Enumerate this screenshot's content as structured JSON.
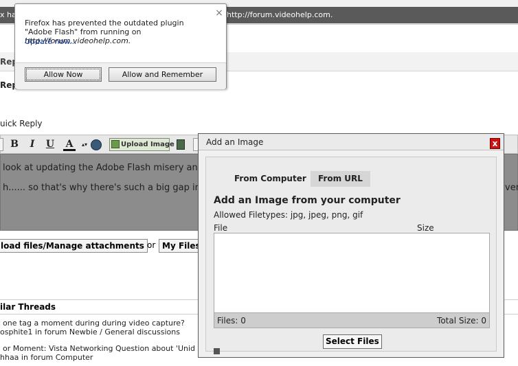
{
  "browser": {
    "notif_left": "x ha",
    "notif_right": "http://forum.videohelp.com."
  },
  "plugin_popup": {
    "message": "Firefox has prevented the outdated plugin \"Adobe Flash\" from running on",
    "url": "http://forum.videohelp.com.",
    "update_link": "Update now...",
    "allow_now": "Allow Now",
    "allow_remember": "Allow and Remember",
    "close": "×"
  },
  "forum": {
    "bar1_label": "Rep",
    "bar2_label": "Repl",
    "quick_reply": "uick Reply",
    "editor_line1": "look at updating the Adobe Flash misery and",
    "editor_line2": "h...... so that's why there's such a big gap in t",
    "editor_line2_right": "ver",
    "upload_manage": "load files/Manage attachments",
    "or": "or",
    "my_files": "My Files",
    "similar_threads": "ilar Threads",
    "threads": [
      {
        "title": "one tag a moment during during video capture?",
        "sub": "osphite1 in forum Newbie / General discussions"
      },
      {
        "title": "or Moment: Vista Networking Question about 'Unid",
        "sub": "hhaa in forum Computer"
      }
    ],
    "toolbar": {
      "bold": "B",
      "italic": "I",
      "underline": "U",
      "font_color": "A",
      "upload_image": "Upload Image"
    }
  },
  "image_dialog": {
    "title": "Add an Image",
    "close": "x",
    "tabs": [
      "From Computer",
      "From URL"
    ],
    "heading": "Add an Image from your computer",
    "allowed": "Allowed Filetypes: jpg, jpeg, png, gif",
    "col_file": "File",
    "col_size": "Size",
    "files_count": "Files: 0",
    "total_size": "Total Size: 0",
    "select_files": "Select Files"
  }
}
